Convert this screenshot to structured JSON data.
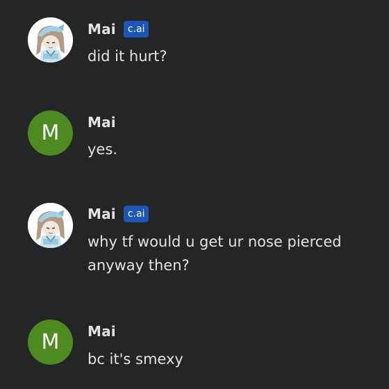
{
  "messages": [
    {
      "sender": "Mai",
      "badge": "c.ai",
      "avatar": "character-avatar-icon",
      "text": "did it hurt?"
    },
    {
      "sender": "Mai",
      "badge": "",
      "avatar": "letter-avatar",
      "avatar_letter": "M",
      "text": "yes."
    },
    {
      "sender": "Mai",
      "badge": "c.ai",
      "avatar": "character-avatar-icon",
      "text": "why tf would u get ur nose pierced anyway then?"
    },
    {
      "sender": "Mai",
      "badge": "",
      "avatar": "letter-avatar",
      "avatar_letter": "M",
      "text": "bc it's smexy"
    }
  ],
  "colors": {
    "background": "#242526",
    "text": "#e2e3e4",
    "badge": "#1c57b8",
    "user_avatar": "#4d8a1f"
  }
}
